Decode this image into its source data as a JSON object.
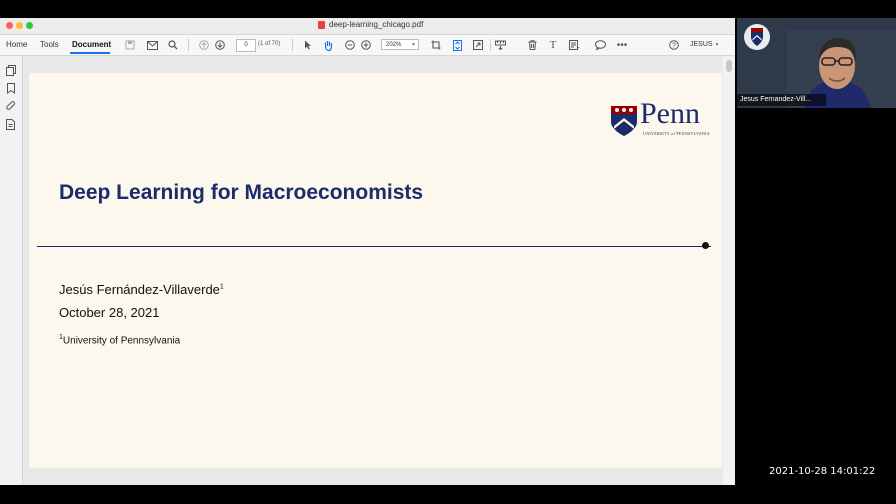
{
  "window": {
    "title": "deep-learning_chicago.pdf"
  },
  "toolbar": {
    "tabs": [
      "Home",
      "Tools",
      "Document"
    ],
    "active_tab": "Document",
    "page_input": "0",
    "page_count": "(1 of 70)",
    "zoom": "202%",
    "user": "JESUS"
  },
  "slide": {
    "title": "Deep Learning for Macroeconomists",
    "author": "Jesús Fernández-Villaverde",
    "author_mark": "1",
    "date": "October 28, 2021",
    "affil_mark": "1",
    "affiliation": "University of Pennsylvania",
    "logo": {
      "word": "Penn",
      "sub": "UNIVERSITY of PENNSYLVANIA"
    }
  },
  "video": {
    "participant": "Jesus Fernandez-Vill..."
  },
  "timestamp": "2021-10-28  14:01:22",
  "colors": {
    "penn_blue": "#1b2b6b",
    "penn_red": "#990000",
    "accent": "#1473e6",
    "slide_bg": "#fdf8ee"
  }
}
